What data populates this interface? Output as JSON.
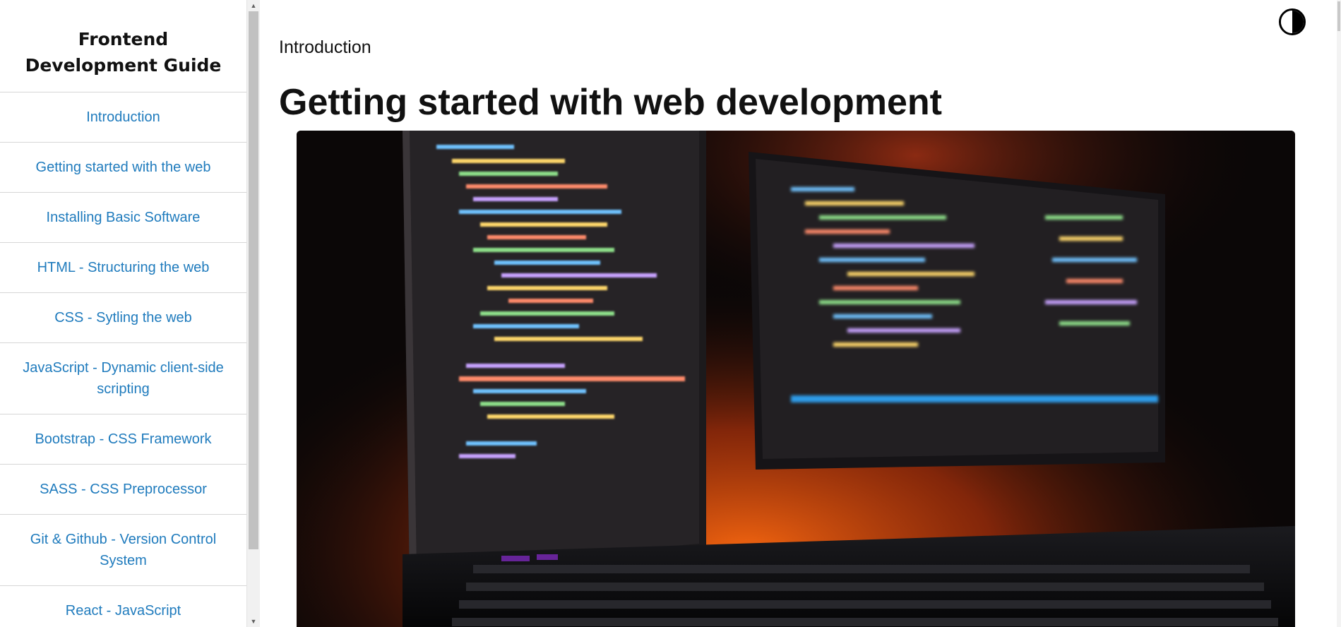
{
  "sidebar": {
    "title": "Frontend Development Guide",
    "items": [
      {
        "label": "Introduction"
      },
      {
        "label": "Getting started with the web"
      },
      {
        "label": "Installing Basic Software"
      },
      {
        "label": "HTML - Structuring the web"
      },
      {
        "label": "CSS - Sytling the web"
      },
      {
        "label": "JavaScript - Dynamic client-side scripting"
      },
      {
        "label": "Bootstrap - CSS Framework"
      },
      {
        "label": "SASS - CSS Preprocessor"
      },
      {
        "label": "Git & Github - Version Control System"
      },
      {
        "label": "React - JavaScript"
      }
    ]
  },
  "main": {
    "section_label": "Introduction",
    "title": "Getting started with web development",
    "theme_toggle_icon": "contrast-icon",
    "hero_image_icon": "code-monitors-photo"
  },
  "colors": {
    "link": "#1f7bbd",
    "divider": "#d6d6d6",
    "text": "#111111"
  }
}
